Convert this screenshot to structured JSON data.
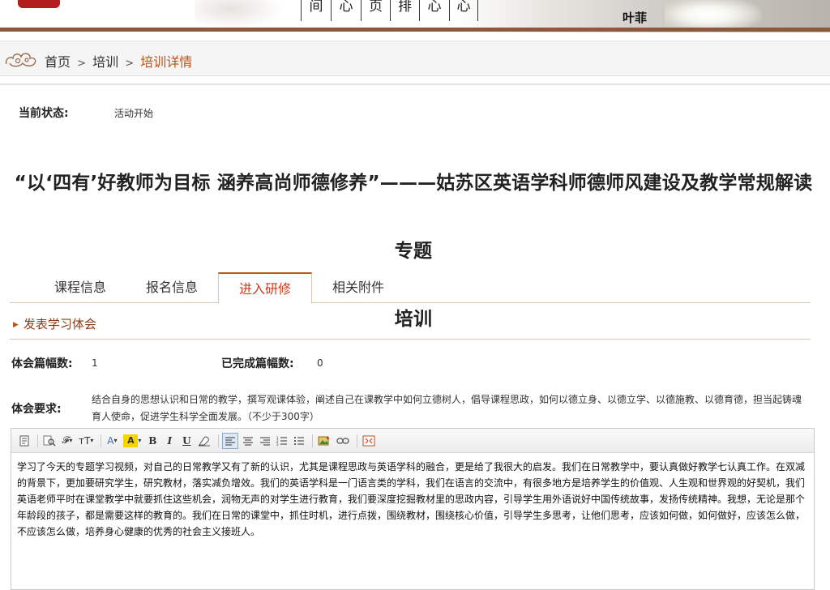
{
  "banner": {
    "nav_cells": [
      "间",
      "心",
      "页",
      "排",
      "心",
      "心"
    ],
    "user_name": "叶菲",
    "accent_color": "#8b5a3c"
  },
  "breadcrumb": {
    "home": "首页",
    "separator": ">",
    "training": "培训",
    "current": "培训详情"
  },
  "status": {
    "label": "当前状态:",
    "value": "活动开始"
  },
  "title": {
    "line1": "“以‘四有’好教师为目标 涵养高尚师德修养”———姑苏区英语学科师德师风建设及教学常规解读专题",
    "line2": "培训"
  },
  "tabs": [
    {
      "label": "课程信息",
      "active": false
    },
    {
      "label": "报名信息",
      "active": false
    },
    {
      "label": "进入研修",
      "active": true
    },
    {
      "label": "相关附件",
      "active": false
    }
  ],
  "section": {
    "title": "发表学习体会"
  },
  "counts": {
    "total_label": "体会篇幅数:",
    "total_value": "1",
    "done_label": "已完成篇幅数:",
    "done_value": "0"
  },
  "requirement": {
    "label": "体会要求:",
    "text": "结合自身的思想认识和日常的教学，撰写观课体验，阐述自己在课教学中如何立德树人，倡导课程思政，如何以德立身、以德立学、以德施教、以德育德，担当起铸魂育人使命，促进学生科学全面发展。（不少于300字）"
  },
  "editor": {
    "toolbar": {
      "font_family": "𝓕",
      "font_size": "тT",
      "font_color": "A",
      "highlight": "A",
      "bold": "B",
      "italic": "I",
      "underline": "U"
    },
    "content": "学习了今天的专题学习视频，对自己的日常教学又有了新的认识，尤其是课程思政与英语学科的融合，更是给了我很大的启发。我们在日常教学中，要认真做好教学七认真工作。在双减的背景下，更加要研究学生，研究教材，落实减负增效。我们的英语学科是一门语言类的学科，我们在语言的交流中，有很多地方是培养学生的价值观、人生观和世界观的好契机，我们英语老师平时在课堂教学中就要抓住这些机会，润物无声的对学生进行教育，我们要深度挖掘教材里的思政内容，引导学生用外语说好中国传统故事，发扬传统精神。我想，无论是那个年龄段的孩子，都是需要这样的教育的。我们在日常的课堂中，抓住时机，进行点拨，围绕教材，围绕核心价值，引导学生多思考，让他们思考，应该如何做，如何做好，应该怎么做，不应该怎么做，培养身心健康的优秀的社会主义接班人。"
  }
}
